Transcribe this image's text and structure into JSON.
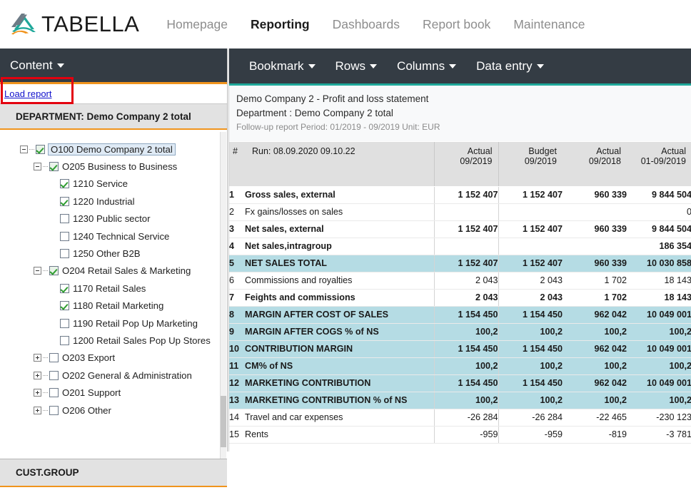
{
  "app": {
    "brand": "TABELLA",
    "logo_colors": {
      "teal": "#1fa89a",
      "gray": "#6d7b86",
      "orange": "#f0941d"
    }
  },
  "topnav": {
    "items": [
      {
        "label": "Homepage",
        "active": false
      },
      {
        "label": "Reporting",
        "active": true
      },
      {
        "label": "Dashboards",
        "active": false
      },
      {
        "label": "Report book",
        "active": false
      },
      {
        "label": "Maintenance",
        "active": false
      }
    ]
  },
  "sidebar": {
    "menu_label": "Content",
    "load_report_label": "Load report",
    "department_header": "DEPARTMENT: Demo Company 2 total",
    "cust_group_header": "CUST.GROUP",
    "tree": [
      {
        "label": "O100 Demo Company 2 total",
        "level": 0,
        "checked": true,
        "toggle": "minus",
        "selected": true
      },
      {
        "label": "O205 Business to Business",
        "level": 1,
        "checked": true,
        "toggle": "minus",
        "selected": false
      },
      {
        "label": "1210 Service",
        "level": 2,
        "checked": true,
        "toggle": "none",
        "selected": false
      },
      {
        "label": "1220 Industrial",
        "level": 2,
        "checked": true,
        "toggle": "none",
        "selected": false
      },
      {
        "label": "1230 Public sector",
        "level": 2,
        "checked": false,
        "toggle": "none",
        "selected": false
      },
      {
        "label": "1240 Technical Service",
        "level": 2,
        "checked": false,
        "toggle": "none",
        "selected": false
      },
      {
        "label": "1250 Other B2B",
        "level": 2,
        "checked": false,
        "toggle": "none",
        "selected": false
      },
      {
        "label": "O204 Retail Sales & Marketing",
        "level": 1,
        "checked": true,
        "toggle": "minus",
        "selected": false
      },
      {
        "label": "1170 Retail Sales",
        "level": 2,
        "checked": true,
        "toggle": "none",
        "selected": false
      },
      {
        "label": "1180 Retail Marketing",
        "level": 2,
        "checked": true,
        "toggle": "none",
        "selected": false
      },
      {
        "label": "1190 Retail Pop Up Marketing",
        "level": 2,
        "checked": false,
        "toggle": "none",
        "selected": false
      },
      {
        "label": "1200 Retail Sales Pop Up Stores",
        "level": 2,
        "checked": false,
        "toggle": "none",
        "selected": false
      },
      {
        "label": "O203 Export",
        "level": 1,
        "checked": false,
        "toggle": "plus",
        "selected": false
      },
      {
        "label": "O202 General & Administration",
        "level": 1,
        "checked": false,
        "toggle": "plus",
        "selected": false
      },
      {
        "label": "O201 Support",
        "level": 1,
        "checked": false,
        "toggle": "plus",
        "selected": false
      },
      {
        "label": "O206 Other",
        "level": 1,
        "checked": false,
        "toggle": "plus",
        "selected": false
      }
    ]
  },
  "toolbar": {
    "items": [
      {
        "label": "Bookmark"
      },
      {
        "label": "Rows"
      },
      {
        "label": "Columns"
      },
      {
        "label": "Data entry"
      }
    ]
  },
  "report": {
    "title": "Demo Company 2 - Profit and loss statement",
    "department": "Department : Demo Company 2 total",
    "period": "Follow-up report Period: 01/2019 - 09/2019 Unit: EUR",
    "run_label": "Run: 08.09.2020 09.10.22",
    "num_header": "#",
    "columns": [
      {
        "line1": "Actual",
        "line2": "09/2019"
      },
      {
        "line1": "Budget",
        "line2": "09/2019"
      },
      {
        "line1": "Actual",
        "line2": "09/2018"
      },
      {
        "line1": "Actual",
        "line2": "01-09/2019"
      }
    ],
    "rows": [
      {
        "n": "1",
        "desc": "Gross sales, external",
        "vals": [
          "1 152 407",
          "1 152 407",
          "960 339",
          "9 844 504"
        ],
        "bold": true,
        "hl": false
      },
      {
        "n": "2",
        "desc": "Fx gains/losses on sales",
        "vals": [
          "",
          "",
          "",
          "0"
        ],
        "bold": false,
        "hl": false
      },
      {
        "n": "3",
        "desc": "Net sales, external",
        "vals": [
          "1 152 407",
          "1 152 407",
          "960 339",
          "9 844 504"
        ],
        "bold": true,
        "hl": false
      },
      {
        "n": "4",
        "desc": "Net sales,intragroup",
        "vals": [
          "",
          "",
          "",
          "186 354"
        ],
        "bold": true,
        "hl": false
      },
      {
        "n": "5",
        "desc": "NET SALES TOTAL",
        "vals": [
          "1 152 407",
          "1 152 407",
          "960 339",
          "10 030 858"
        ],
        "bold": true,
        "hl": true
      },
      {
        "n": "6",
        "desc": "Commissions and royalties",
        "vals": [
          "2 043",
          "2 043",
          "1 702",
          "18 143"
        ],
        "bold": false,
        "hl": false
      },
      {
        "n": "7",
        "desc": "Feights and commissions",
        "vals": [
          "2 043",
          "2 043",
          "1 702",
          "18 143"
        ],
        "bold": true,
        "hl": false
      },
      {
        "n": "8",
        "desc": "MARGIN AFTER COST OF SALES",
        "vals": [
          "1 154 450",
          "1 154 450",
          "962 042",
          "10 049 001"
        ],
        "bold": true,
        "hl": true
      },
      {
        "n": "9",
        "desc": "MARGIN AFTER COGS % of NS",
        "vals": [
          "100,2",
          "100,2",
          "100,2",
          "100,2"
        ],
        "bold": true,
        "hl": true
      },
      {
        "n": "10",
        "desc": "CONTRIBUTION MARGIN",
        "vals": [
          "1 154 450",
          "1 154 450",
          "962 042",
          "10 049 001"
        ],
        "bold": true,
        "hl": true
      },
      {
        "n": "11",
        "desc": "CM% of NS",
        "vals": [
          "100,2",
          "100,2",
          "100,2",
          "100,2"
        ],
        "bold": true,
        "hl": true
      },
      {
        "n": "12",
        "desc": "MARKETING CONTRIBUTION",
        "vals": [
          "1 154 450",
          "1 154 450",
          "962 042",
          "10 049 001"
        ],
        "bold": true,
        "hl": true
      },
      {
        "n": "13",
        "desc": "MARKETING CONTRIBUTION % of NS",
        "vals": [
          "100,2",
          "100,2",
          "100,2",
          "100,2"
        ],
        "bold": true,
        "hl": true
      },
      {
        "n": "14",
        "desc": "Travel and car expenses",
        "vals": [
          "-26 284",
          "-26 284",
          "-22 465",
          "-230 123"
        ],
        "bold": false,
        "hl": false
      },
      {
        "n": "15",
        "desc": "Rents",
        "vals": [
          "-959",
          "-959",
          "-819",
          "-3 781"
        ],
        "bold": false,
        "hl": false
      }
    ]
  },
  "annotation": {
    "color": "#e3000f",
    "target": "load-report-link"
  }
}
